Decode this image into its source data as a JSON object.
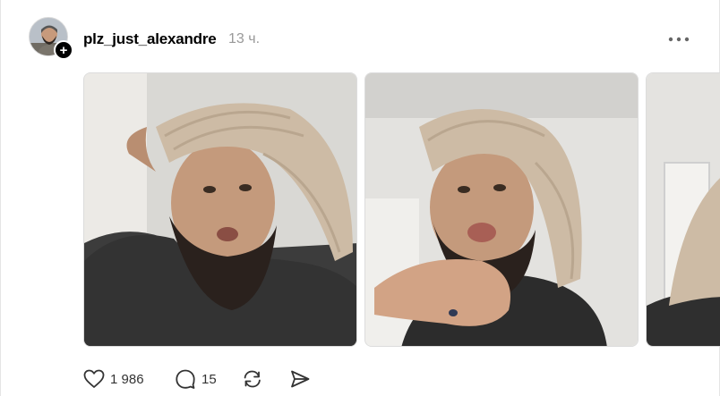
{
  "post": {
    "username": "plz_just_alexandre",
    "time": "13 ч.",
    "follow_symbol": "+",
    "likes": "1 986",
    "replies": "15"
  },
  "icons": {
    "avatar": "avatar-image",
    "follow": "plus-icon",
    "more": "more-horizontal-icon",
    "like": "heart-icon",
    "reply": "comment-bubble-icon",
    "repost": "repost-icon",
    "share": "send-icon"
  },
  "colors": {
    "text": "#000000",
    "muted": "#999999",
    "icon": "#333333"
  }
}
